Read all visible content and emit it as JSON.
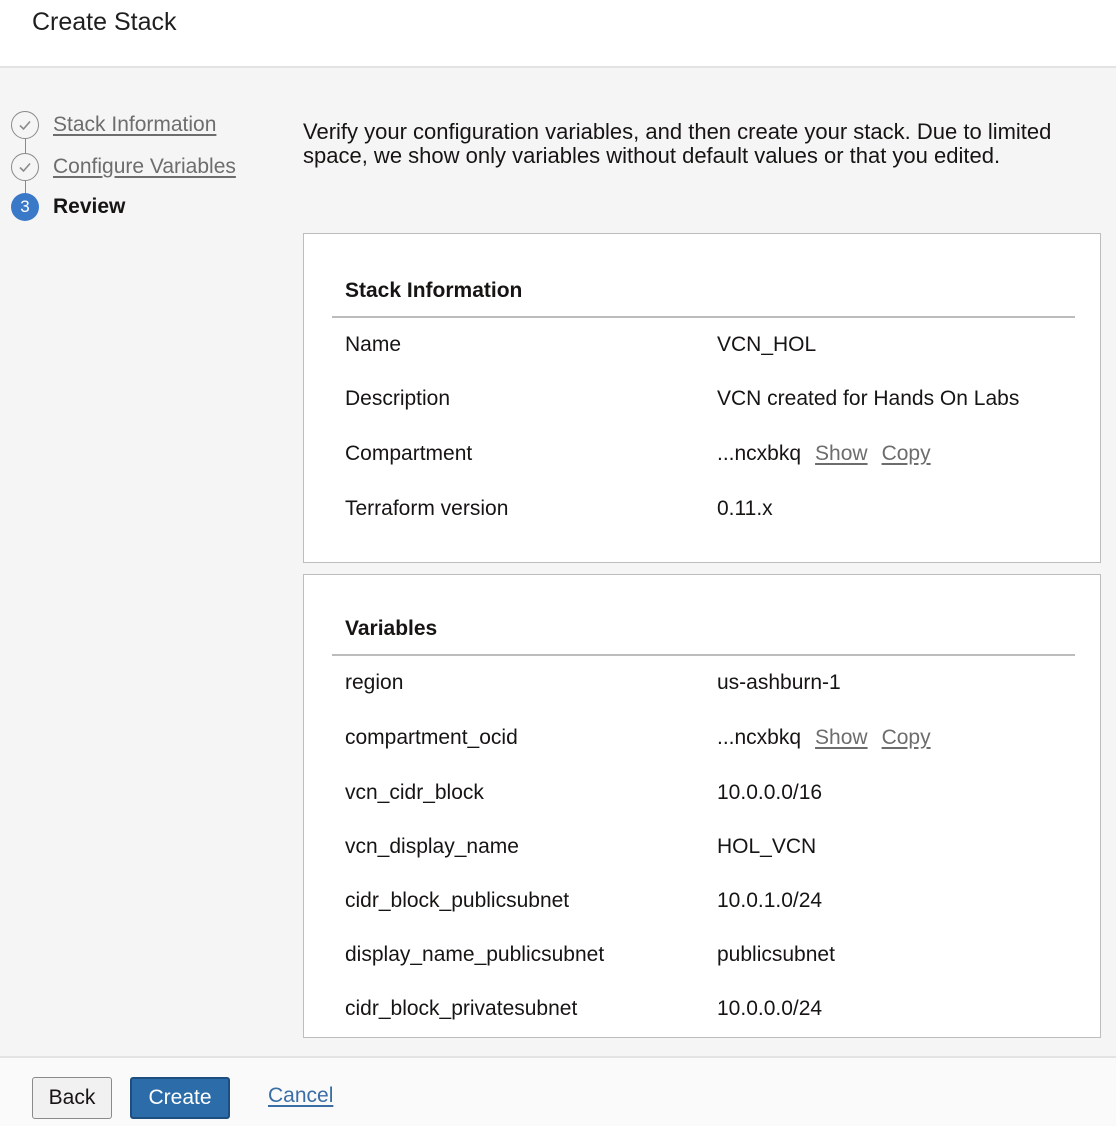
{
  "header": {
    "title": "Create Stack"
  },
  "steps": [
    {
      "number": "",
      "label": "Stack Information",
      "state": "done"
    },
    {
      "number": "",
      "label": "Configure Variables",
      "state": "done"
    },
    {
      "number": "3",
      "label": "Review",
      "state": "current"
    }
  ],
  "intro": "Verify your configuration variables, and then create your stack. Due to limited space, we show only variables without default values or that you edited.",
  "stack_info": {
    "title": "Stack Information",
    "rows": [
      {
        "label": "Name",
        "value": "VCN_HOL"
      },
      {
        "label": "Description",
        "value": "VCN created for Hands On Labs"
      },
      {
        "label": "Compartment",
        "value": "...ncxbkq",
        "show": "Show",
        "copy": "Copy"
      },
      {
        "label": "Terraform version",
        "value": "0.11.x"
      }
    ]
  },
  "variables": {
    "title": "Variables",
    "rows": [
      {
        "label": "region",
        "value": "us-ashburn-1"
      },
      {
        "label": "compartment_ocid",
        "value": "...ncxbkq",
        "show": "Show",
        "copy": "Copy"
      },
      {
        "label": "vcn_cidr_block",
        "value": "10.0.0.0/16"
      },
      {
        "label": "vcn_display_name",
        "value": "HOL_VCN"
      },
      {
        "label": "cidr_block_publicsubnet",
        "value": "10.0.1.0/24"
      },
      {
        "label": "display_name_publicsubnet",
        "value": "publicsubnet"
      },
      {
        "label": "cidr_block_privatesubnet",
        "value": "10.0.0.0/24"
      }
    ]
  },
  "footer": {
    "back": "Back",
    "create": "Create",
    "cancel": "Cancel"
  },
  "colors": {
    "primary_button": "#2c6ca8",
    "step_current": "#3a79c8",
    "link": "#3a6ea5"
  }
}
